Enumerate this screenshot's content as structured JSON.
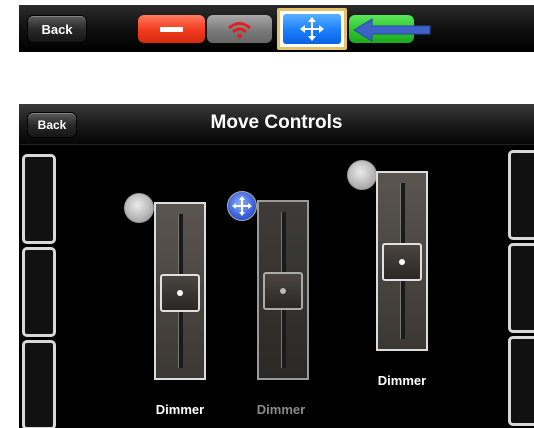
{
  "toolbar": {
    "back_label": "Back",
    "buttons": [
      {
        "name": "remove",
        "icon": "minus-icon",
        "color": "#f23a1c"
      },
      {
        "name": "wifi",
        "icon": "wifi-icon",
        "color": "#7a7a7a"
      },
      {
        "name": "move",
        "icon": "move-arrows-icon",
        "color": "#1a7dff",
        "selected": true
      },
      {
        "name": "green",
        "icon": "",
        "color": "#2cc62c"
      }
    ],
    "pointer_icon": "left-arrow-pointer-icon"
  },
  "screen": {
    "back_label": "Back",
    "title": "Move Controls",
    "sliders": [
      {
        "label": "Dimmer",
        "level": 0.5,
        "handle": "grey-circle-handle",
        "dimmed": false
      },
      {
        "label": "Dimmer",
        "level": 0.5,
        "handle": "move-arrows-icon",
        "dimmed": true
      },
      {
        "label": "Dimmer",
        "level": 0.5,
        "handle": "grey-circle-handle",
        "dimmed": false
      }
    ]
  }
}
